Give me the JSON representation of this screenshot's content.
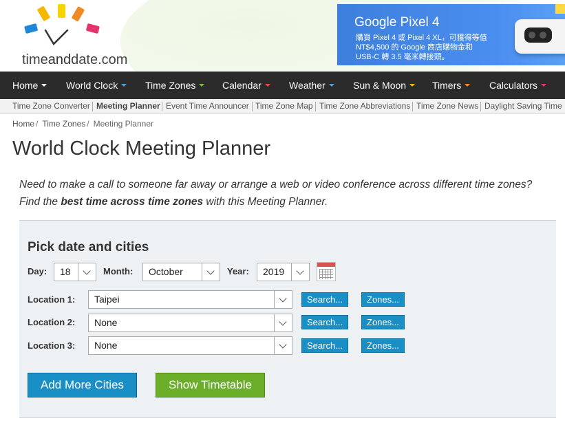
{
  "brand": {
    "logo_text_pre": "time",
    "logo_text_hl": "and",
    "logo_text_post": "date.com"
  },
  "ad": {
    "title": "Google Pixel 4",
    "body": "購買 Pixel 4 或 Pixel 4 XL，可獲得等值\nNT$4,500 的 Google 商店購物金和\nUSB-C 轉 3.5 毫米轉接頭。"
  },
  "nav": {
    "items": [
      {
        "label": "Home",
        "caret_color": "#ffffff"
      },
      {
        "label": "World Clock",
        "caret_color": "#4aa3df"
      },
      {
        "label": "Time Zones",
        "caret_color": "#7cbf3b"
      },
      {
        "label": "Calendar",
        "caret_color": "#e84c3d"
      },
      {
        "label": "Weather",
        "caret_color": "#4aa3df"
      },
      {
        "label": "Sun & Moon",
        "caret_color": "#f5b700"
      },
      {
        "label": "Timers",
        "caret_color": "#f08a24"
      },
      {
        "label": "Calculators",
        "caret_color": "#e6336b"
      }
    ]
  },
  "subnav": {
    "items": [
      {
        "label": "Time Zone Converter",
        "active": false
      },
      {
        "label": "Meeting Planner",
        "active": true
      },
      {
        "label": "Event Time Announcer",
        "active": false
      },
      {
        "label": "Time Zone Map",
        "active": false
      },
      {
        "label": "Time Zone Abbreviations",
        "active": false
      },
      {
        "label": "Time Zone News",
        "active": false
      },
      {
        "label": "Daylight Saving Time",
        "active": false
      }
    ]
  },
  "breadcrumb": {
    "items": [
      "Home",
      "Time Zones",
      "Meeting Planner"
    ]
  },
  "page_title": "World Clock Meeting Planner",
  "intro": {
    "line1": "Need to make a call to someone far away or arrange a web or video conference across different time zones?",
    "line2_pre": "Find the ",
    "line2_bold": "best time across time zones",
    "line2_post": " with this Meeting Planner."
  },
  "form": {
    "title": "Pick date and cities",
    "day_label": "Day:",
    "day_value": "18",
    "month_label": "Month:",
    "month_value": "October",
    "year_label": "Year:",
    "year_value": "2019",
    "locations": [
      {
        "label": "Location 1:",
        "value": "Taipei"
      },
      {
        "label": "Location 2:",
        "value": "None"
      },
      {
        "label": "Location 3:",
        "value": "None"
      }
    ],
    "search_label": "Search...",
    "zones_label": "Zones...",
    "add_more_label": "Add More Cities",
    "show_timetable_label": "Show Timetable"
  },
  "colors": {
    "nav_bg": "#2b2b2b",
    "button_blue": "#1a8fc6",
    "button_green": "#6aae2a",
    "panel_bg": "#eef1f4"
  }
}
